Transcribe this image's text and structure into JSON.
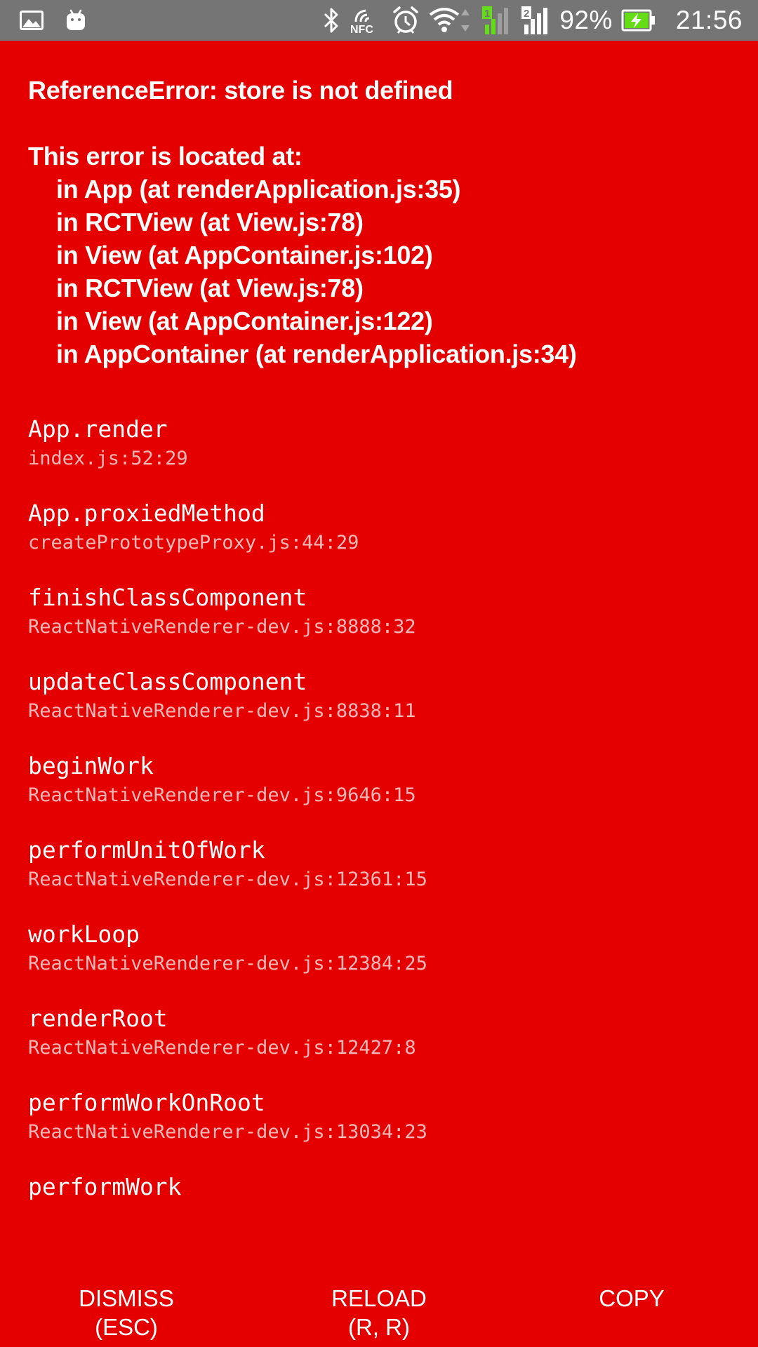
{
  "status_bar": {
    "left_icons": [
      "image-icon",
      "android-icon"
    ],
    "right_icons": [
      "bluetooth-icon",
      "nfc-icon",
      "alarm-icon",
      "wifi-icon",
      "sim1-signal-icon",
      "sim2-signal-icon",
      "battery-charging-icon"
    ],
    "nfc_label": "NFC",
    "battery_percent": "92%",
    "time": "21:56"
  },
  "error": {
    "title": "ReferenceError: store is not defined",
    "location_header": "This error is located at:",
    "location_lines": [
      "in App (at renderApplication.js:35)",
      "in RCTView (at View.js:78)",
      "in View (at AppContainer.js:102)",
      "in RCTView (at View.js:78)",
      "in View (at AppContainer.js:122)",
      "in AppContainer (at renderApplication.js:34)"
    ]
  },
  "stack": [
    {
      "method": "App.render",
      "file": "index.js:52:29"
    },
    {
      "method": "App.proxiedMethod",
      "file": "createPrototypeProxy.js:44:29"
    },
    {
      "method": "finishClassComponent",
      "file": "ReactNativeRenderer-dev.js:8888:32"
    },
    {
      "method": "updateClassComponent",
      "file": "ReactNativeRenderer-dev.js:8838:11"
    },
    {
      "method": "beginWork",
      "file": "ReactNativeRenderer-dev.js:9646:15"
    },
    {
      "method": "performUnitOfWork",
      "file": "ReactNativeRenderer-dev.js:12361:15"
    },
    {
      "method": "workLoop",
      "file": "ReactNativeRenderer-dev.js:12384:25"
    },
    {
      "method": "renderRoot",
      "file": "ReactNativeRenderer-dev.js:12427:8"
    },
    {
      "method": "performWorkOnRoot",
      "file": "ReactNativeRenderer-dev.js:13034:23"
    },
    {
      "method": "performWork",
      "file": ""
    }
  ],
  "buttons": {
    "dismiss": {
      "label": "DISMISS",
      "hint": "(ESC)"
    },
    "reload": {
      "label": "RELOAD",
      "hint": "(R, R)"
    },
    "copy": {
      "label": "COPY"
    }
  },
  "colors": {
    "background": "#e50000",
    "status_bar": "#757575",
    "battery_fill": "#64dd17"
  }
}
